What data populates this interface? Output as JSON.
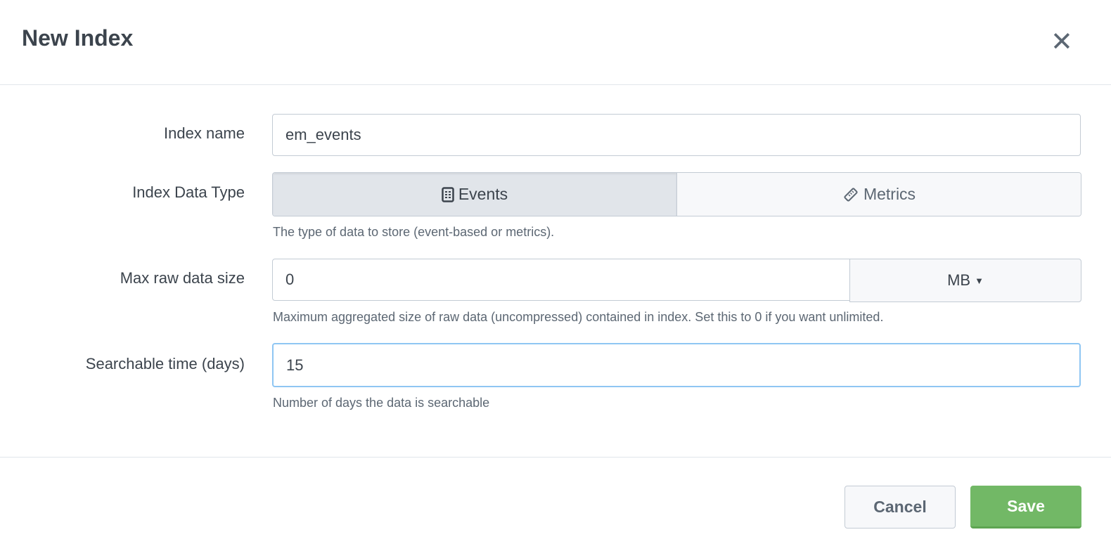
{
  "dialog": {
    "title": "New Index",
    "close_icon": "close-icon"
  },
  "fields": {
    "index_name": {
      "label": "Index name",
      "value": "em_events"
    },
    "data_type": {
      "label": "Index Data Type",
      "options": [
        "Events",
        "Metrics"
      ],
      "selected": "Events",
      "help": "The type of data to store (event-based or metrics)."
    },
    "max_size": {
      "label": "Max raw data size",
      "value": "0",
      "unit": "MB",
      "help": "Maximum aggregated size of raw data (uncompressed) contained in index. Set this to 0 if you want unlimited."
    },
    "searchable": {
      "label": "Searchable time (days)",
      "value": "15",
      "help": "Number of days the data is searchable"
    }
  },
  "buttons": {
    "cancel": "Cancel",
    "save": "Save"
  },
  "colors": {
    "save": "#72b866",
    "focus": "#8fc6f3"
  }
}
